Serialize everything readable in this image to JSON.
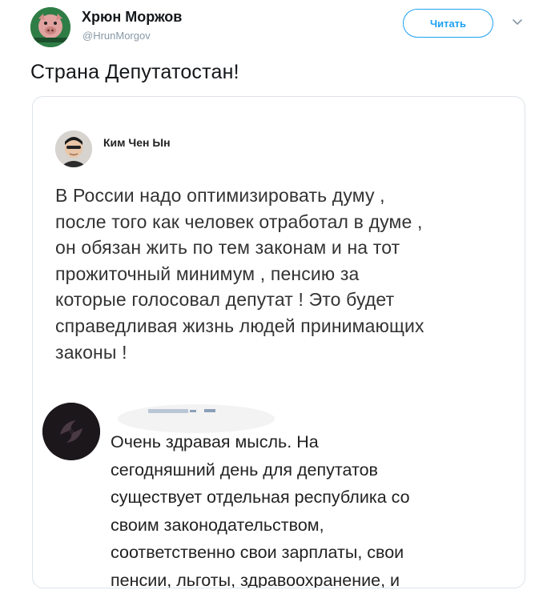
{
  "tweet": {
    "author_name": "Хрюн Моржов",
    "author_handle": "@HrunMorgov",
    "follow_label": "Читать",
    "text": "Страна Депутатостан!"
  },
  "embedded_post": {
    "author_name": "Ким Чен Ын",
    "text": "В России надо оптимизировать думу ,\nпосле того как человек отработал в думе ,\nон обязан жить по тем законам  и на тот\nпрожиточный минимум , пенсию за\nкоторые голосовал депутат ! Это будет\nсправедливая жизнь людей принимающих\nзаконы !"
  },
  "comment": {
    "text": "Очень здравая мысль. На\nсегодняшний день для депутатов\nсуществует отдельная республика со\nсвоим законодательством,\nсоответственно свои зарплаты, свои\nпенсии, льготы, здравоохранение, и"
  },
  "colors": {
    "accent": "#1da1f2",
    "secondary_text": "#8899a6",
    "border": "#dde3e8"
  },
  "icons": {
    "menu": "chevron-down-icon"
  }
}
